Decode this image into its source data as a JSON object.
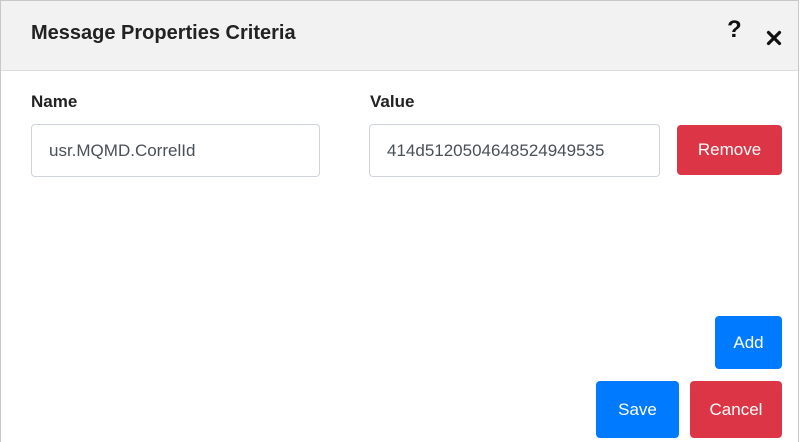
{
  "dialog": {
    "title": "Message Properties Criteria",
    "help_label": "?"
  },
  "criteria": {
    "name_label": "Name",
    "value_label": "Value",
    "rows": [
      {
        "name": "usr.MQMD.CorrelId",
        "value": "414d5120504648524949535"
      }
    ]
  },
  "buttons": {
    "remove": "Remove",
    "add": "Add",
    "save": "Save",
    "cancel": "Cancel"
  },
  "colors": {
    "danger": "#dc3545",
    "primary": "#007bff",
    "header_bg": "#f2f2f2"
  }
}
